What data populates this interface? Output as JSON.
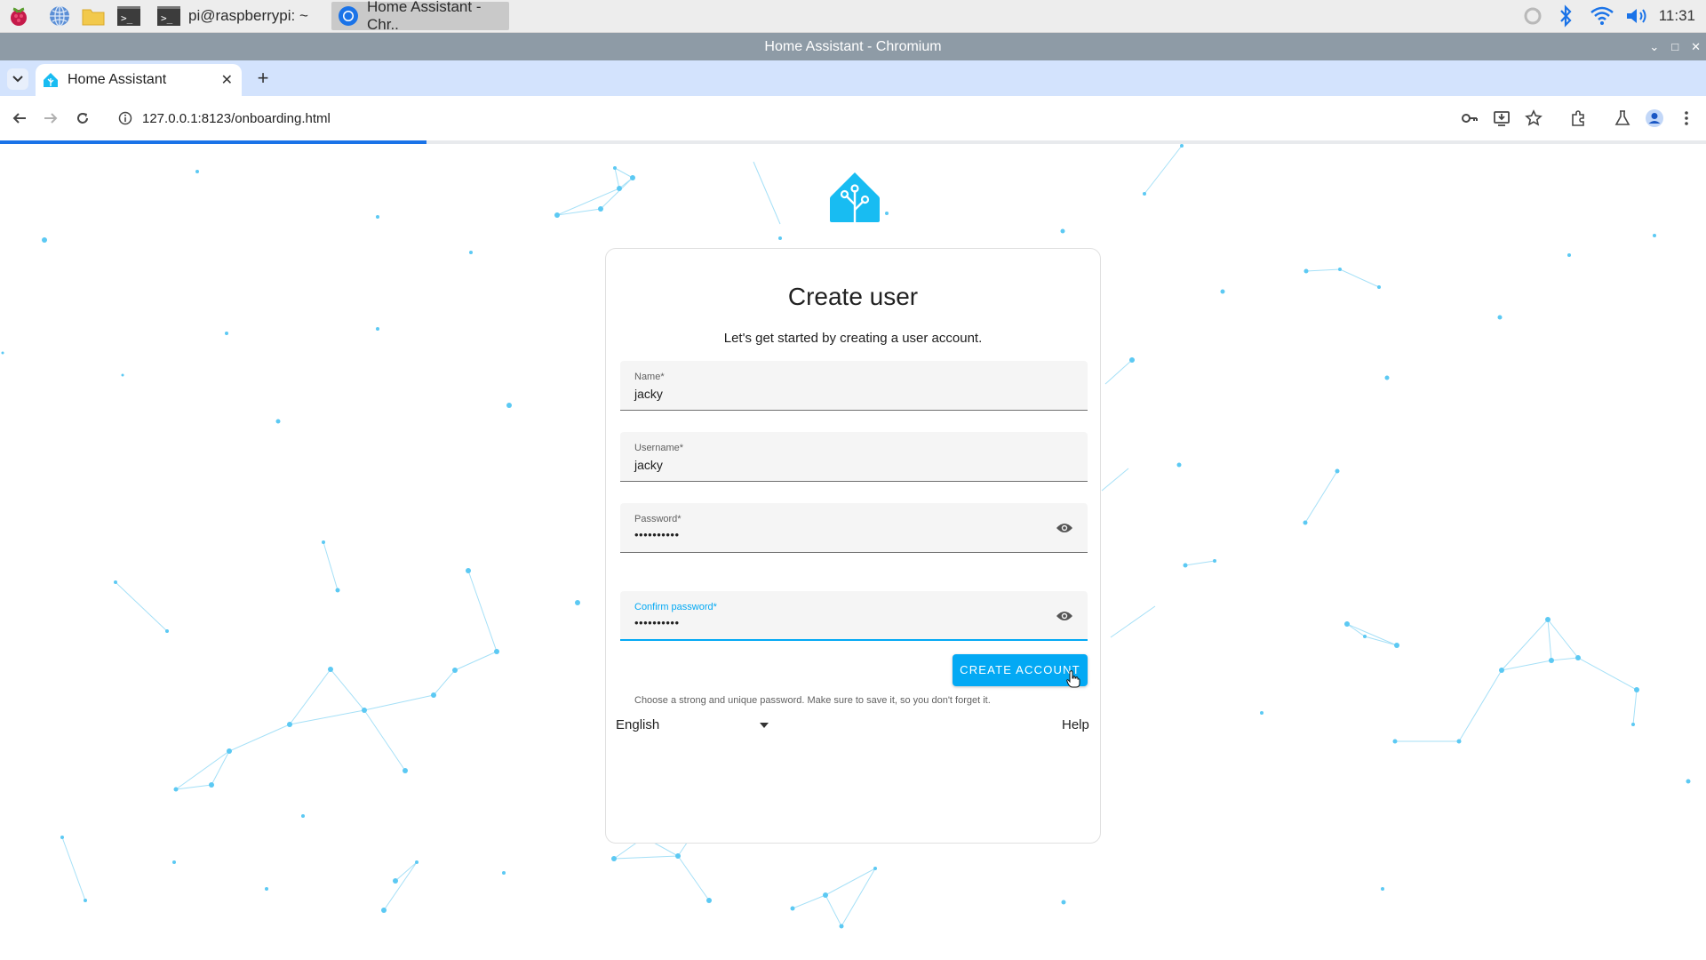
{
  "taskbar": {
    "terminal_task_label": "pi@raspberrypi: ~",
    "browser_task_label": "Home Assistant - Chr..",
    "clock": "11:31"
  },
  "window": {
    "title": "Home Assistant - Chromium"
  },
  "browser": {
    "tab_title": "Home Assistant",
    "url": "127.0.0.1:8123/onboarding.html",
    "load_progress_percent": 25
  },
  "page": {
    "card_title": "Create user",
    "card_subtitle": "Let's get started by creating a user account.",
    "fields": {
      "name": {
        "label": "Name*",
        "value": "jacky"
      },
      "username": {
        "label": "Username*",
        "value": "jacky"
      },
      "password": {
        "label": "Password*",
        "value": "••••••••••"
      },
      "confirm_password": {
        "label": "Confirm password*",
        "value": "••••••••••"
      }
    },
    "password_helper": "Choose a strong and unique password. Make sure to save it, so you don't forget it.",
    "create_button": "CREATE ACCOUNT",
    "language": "English",
    "help_link": "Help"
  },
  "colors": {
    "accent": "#03a9f4",
    "tabstrip": "#d3e3fd",
    "titlebar": "#8e9ba6",
    "network_lines": "#7fd3f5"
  },
  "icons": {
    "password_toggle": "eye-icon",
    "language_dropdown": "caret-down-icon"
  }
}
